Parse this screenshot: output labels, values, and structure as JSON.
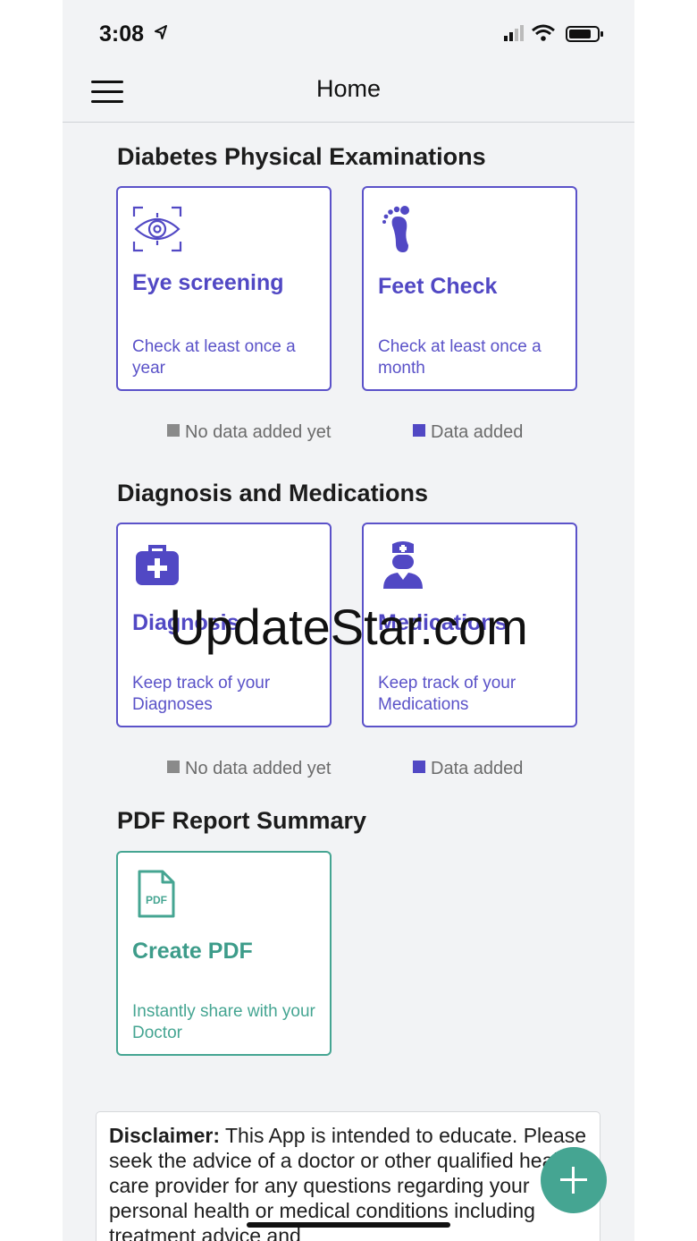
{
  "status_bar": {
    "time": "3:08"
  },
  "nav": {
    "title": "Home"
  },
  "sections": [
    {
      "title": "Diabetes Physical Examinations",
      "cards": [
        {
          "icon": "eye-scan-icon",
          "title": "Eye screening",
          "subtitle": "Check at least once a year"
        },
        {
          "icon": "foot-icon",
          "title": "Feet Check",
          "subtitle": "Check at least once a month"
        }
      ]
    },
    {
      "title": "Diagnosis and Medications",
      "cards": [
        {
          "icon": "medical-kit-icon",
          "title": "Diagnosis",
          "subtitle": "Keep track of your Diagnoses"
        },
        {
          "icon": "doctor-icon",
          "title": "Medications",
          "subtitle": "Keep track of your Medications"
        }
      ]
    },
    {
      "title": "PDF Report Summary",
      "cards": [
        {
          "icon": "pdf-file-icon",
          "title": "Create PDF",
          "subtitle": "Instantly share with your Doctor"
        }
      ]
    }
  ],
  "legend": {
    "no_data": "No data added yet",
    "data_added": "Data added"
  },
  "colors": {
    "accent_purple": "#5148c4",
    "accent_green": "#45a592",
    "no_data_gray": "#8a8a8a"
  },
  "disclaimer": {
    "label": "Disclaimer:",
    "text": " This App is intended to educate. Please seek the advice of a doctor or other qualified health care provider for any questions regarding your personal health or medical conditions including treatment advice and"
  },
  "watermark": "UpdateStar.com"
}
